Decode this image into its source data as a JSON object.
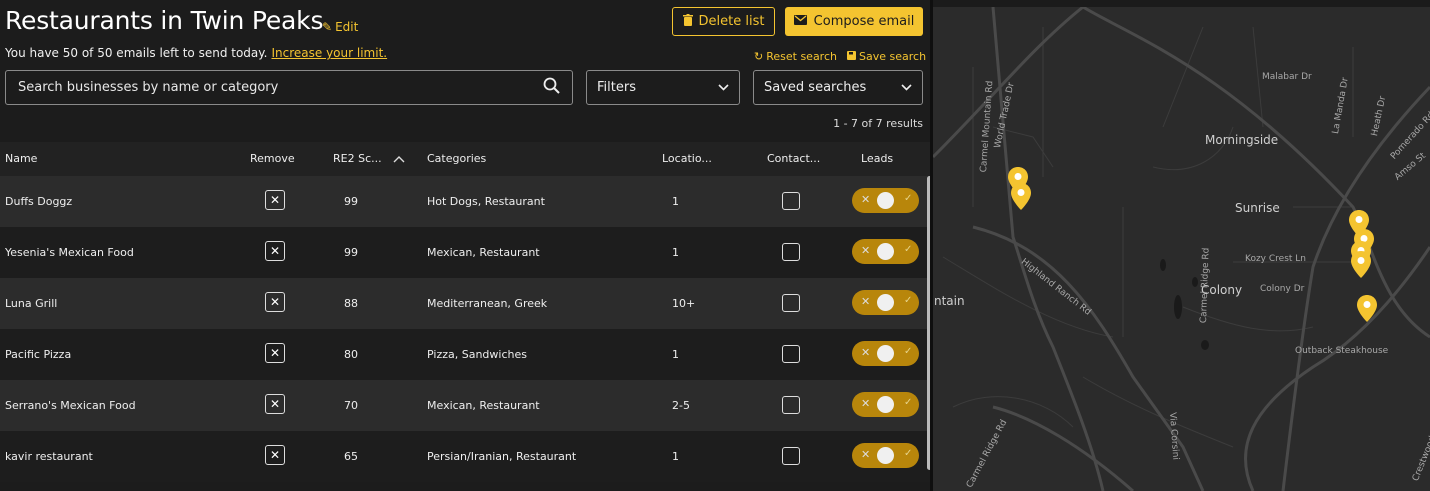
{
  "header": {
    "title": "Restaurants in Twin Peaks",
    "edit_label": "Edit",
    "subtitle": "You have 50 of 50 emails left to send today.",
    "increase_link": "Increase your limit.",
    "delete_label": "Delete list",
    "compose_label": "Compose email",
    "reset_label": "Reset search",
    "save_label": "Save search"
  },
  "search": {
    "placeholder": "Search businesses by name or category"
  },
  "filters": {
    "label": "Filters"
  },
  "saved_searches": {
    "label": "Saved searches"
  },
  "results_count": "1 - 7 of 7 results",
  "table": {
    "headers": {
      "name": "Name",
      "remove": "Remove",
      "score": "RE2 Sc...",
      "categories": "Categories",
      "locations": "Locatio...",
      "contacted": "Contact...",
      "leads": "Leads"
    },
    "rows": [
      {
        "name": "Duffs Doggz",
        "score": "99",
        "categories": "Hot Dogs, Restaurant",
        "locations": "1"
      },
      {
        "name": "Yesenia's Mexican Food",
        "score": "99",
        "categories": "Mexican, Restaurant",
        "locations": "1"
      },
      {
        "name": "Luna Grill",
        "score": "88",
        "categories": "Mediterranean, Greek",
        "locations": "10+"
      },
      {
        "name": "Pacific Pizza",
        "score": "80",
        "categories": "Pizza, Sandwiches",
        "locations": "1"
      },
      {
        "name": "Serrano's Mexican Food",
        "score": "70",
        "categories": "Mexican, Restaurant",
        "locations": "2-5"
      },
      {
        "name": "kavir restaurant",
        "score": "65",
        "categories": "Persian/Iranian, Restaurant",
        "locations": "1"
      }
    ]
  },
  "map": {
    "labels": {
      "morningside": "Morningside",
      "sunrise": "Sunrise",
      "colony": "Colony",
      "ntain": "ntain",
      "outback": "Outback Steakhouse",
      "malabar": "Malabar Dr",
      "kozy": "Kozy Crest Ln",
      "colony_dr": "Colony Dr",
      "world_trade": "World Trade Dr",
      "carmel_mtn": "Carmel Mountain Rd",
      "highland": "Highland Ranch Rd",
      "carmel_ridge": "Carmel Ridge Rd",
      "carmel_ridge2": "Carmel Ridge Rd",
      "la_manda": "La Manda Dr",
      "heath": "Heath Dr",
      "pomerado": "Pomerado Rd",
      "amso": "Amso St",
      "via_corsini": "Via Corsini",
      "crestwood": "Crestwood Ave"
    }
  },
  "colors": {
    "accent": "#f4c430",
    "background": "#1c1c1c",
    "toggle": "#b8860b"
  }
}
